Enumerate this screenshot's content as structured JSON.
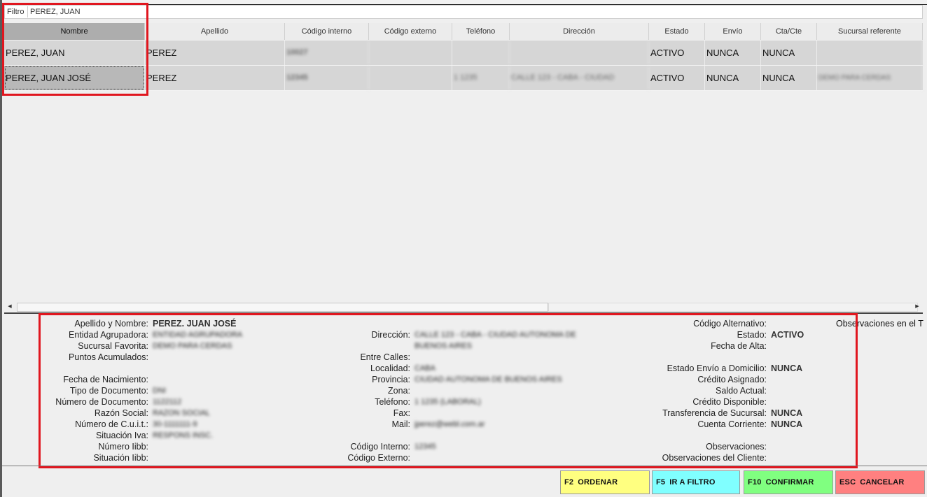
{
  "filter": {
    "label": "Filtro",
    "value": "PEREZ, JUAN"
  },
  "grid": {
    "columns": [
      "Nombre",
      "Apellido",
      "Código interno",
      "Código externo",
      "Teléfono",
      "Dirección",
      "Estado",
      "Envío",
      "Cta/Cte",
      "Sucursal referente"
    ],
    "rows": [
      {
        "nombre": "PEREZ, JUAN",
        "apellido": "PEREZ",
        "codigo_interno": "10027",
        "codigo_externo": "",
        "telefono": "",
        "direccion": "",
        "estado": "ACTIVO",
        "envio": "NUNCA",
        "cta_cte": "NUNCA",
        "sucursal": ""
      },
      {
        "nombre": "PEREZ, JUAN JOSÉ",
        "apellido": "PEREZ",
        "codigo_interno": "12345",
        "codigo_externo": "",
        "telefono": "1 1235",
        "direccion": "CALLE 123 - CABA - CIUDAD",
        "estado": "ACTIVO",
        "envio": "NUNCA",
        "cta_cte": "NUNCA",
        "sucursal": "DEMO PARA CERDAS"
      }
    ]
  },
  "details": {
    "col1": [
      {
        "label": "Apellido y Nombre:",
        "value": "PEREZ. JUAN JOSÉ",
        "bold": true
      },
      {
        "label": "Entidad Agrupadora:",
        "value": "ENTIDAD AGRUPADORA",
        "blur": true
      },
      {
        "label": "Sucursal Favorita:",
        "value": "DEMO PARA CERDAS",
        "blur": true
      },
      {
        "label": "Puntos Acumulados:",
        "value": ""
      },
      {
        "label": "",
        "value": ""
      },
      {
        "label": "Fecha de Nacimiento:",
        "value": ""
      },
      {
        "label": "Tipo de Documento:",
        "value": "DNI",
        "blur": true
      },
      {
        "label": "Número de Documento:",
        "value": "1122112",
        "blur": true
      },
      {
        "label": "Razón Social:",
        "value": "RAZON SOCIAL",
        "blur": true
      },
      {
        "label": "Número de C.u.i.t.:",
        "value": "30-1111111-9",
        "blur": true
      },
      {
        "label": "Situación Iva:",
        "value": "RESPONS INSC.",
        "blur": true
      },
      {
        "label": "Número Iibb:",
        "value": ""
      },
      {
        "label": "Situación Iibb:",
        "value": ""
      }
    ],
    "col2": [
      {
        "label": "",
        "value": ""
      },
      {
        "label": "Dirección:",
        "value": "CALLE 123 - CABA - CIUDAD AUTONOMA DE",
        "blur": true
      },
      {
        "label": "",
        "value": "BUENOS AIRES",
        "blur": true
      },
      {
        "label": "Entre Calles:",
        "value": ""
      },
      {
        "label": "Localidad:",
        "value": "CABA",
        "blur": true
      },
      {
        "label": "Provincia:",
        "value": "CIUDAD AUTONOMA DE BUENOS AIRES",
        "blur": true
      },
      {
        "label": "Zona:",
        "value": ""
      },
      {
        "label": "Teléfono:",
        "value": "1 1235 (LABORAL)",
        "blur": true
      },
      {
        "label": "Fax:",
        "value": ""
      },
      {
        "label": "Mail:",
        "value": "jperez@webl.com.ar",
        "blur": true
      },
      {
        "label": "",
        "value": ""
      },
      {
        "label": "Código Interno:",
        "value": "12345",
        "blur": true
      },
      {
        "label": "Código Externo:",
        "value": ""
      }
    ],
    "col3": [
      {
        "label": "Código Alternativo:",
        "value": ""
      },
      {
        "label": "Estado:",
        "value": "ACTIVO",
        "bold": true
      },
      {
        "label": "Fecha de Alta:",
        "value": ""
      },
      {
        "label": "",
        "value": ""
      },
      {
        "label": "Estado Envío a Domicilio:",
        "value": "NUNCA",
        "bold": true
      },
      {
        "label": "Crédito Asignado:",
        "value": ""
      },
      {
        "label": "Saldo Actual:",
        "value": ""
      },
      {
        "label": "Crédito Disponible:",
        "value": ""
      },
      {
        "label": "Transferencia de Sucursal:",
        "value": "NUNCA",
        "bold": true
      },
      {
        "label": "Cuenta Corriente:",
        "value": "NUNCA",
        "bold": true
      },
      {
        "label": "",
        "value": ""
      },
      {
        "label": "Observaciones:",
        "value": ""
      },
      {
        "label": "Observaciones del Cliente:",
        "value": ""
      }
    ],
    "observaciones_ticket_label": "Observaciones en el T"
  },
  "buttons": [
    {
      "key": "F2",
      "label": "ORDENAR",
      "color": "#ffff80"
    },
    {
      "key": "F5",
      "label": "IR A FILTRO",
      "color": "#80ffff"
    },
    {
      "key": "F10",
      "label": "CONFIRMAR",
      "color": "#80ff80"
    },
    {
      "key": "ESC",
      "label": "CANCELAR",
      "color": "#ff8080"
    }
  ],
  "colors": {
    "highlight": "#e0161f",
    "row_bg": "#d6d6d6",
    "selected_cell": "#b8b8b8"
  }
}
